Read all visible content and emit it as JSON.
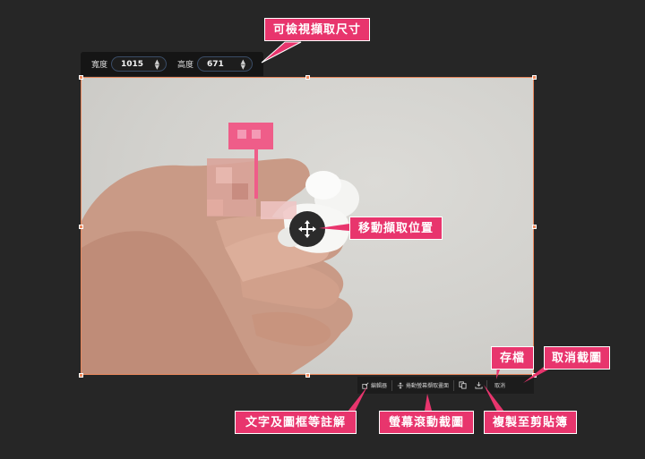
{
  "size_bar": {
    "width_label": "寬度",
    "width_value": "1015",
    "height_label": "高度",
    "height_value": "671"
  },
  "toolbar": {
    "editor_label": "編輯器",
    "scroll_label": "捲動螢幕擷取畫面",
    "cancel_label": "取消"
  },
  "annotations": {
    "resize": "可檢視擷取尺寸",
    "move": "移動擷取位置",
    "save": "存檔",
    "cancel": "取消截圖",
    "annotate": "文字及圖框等註解",
    "scroll": "螢幕滾動截圖",
    "copy": "複製至剪貼簿"
  },
  "icons": {
    "move": "move-arrows-icon",
    "editor": "edit-icon",
    "scroll": "scroll-capture-icon",
    "copy": "copy-icon",
    "save": "download-icon"
  },
  "colors": {
    "accent": "#e8356d",
    "selection_border": "#e8875c"
  }
}
